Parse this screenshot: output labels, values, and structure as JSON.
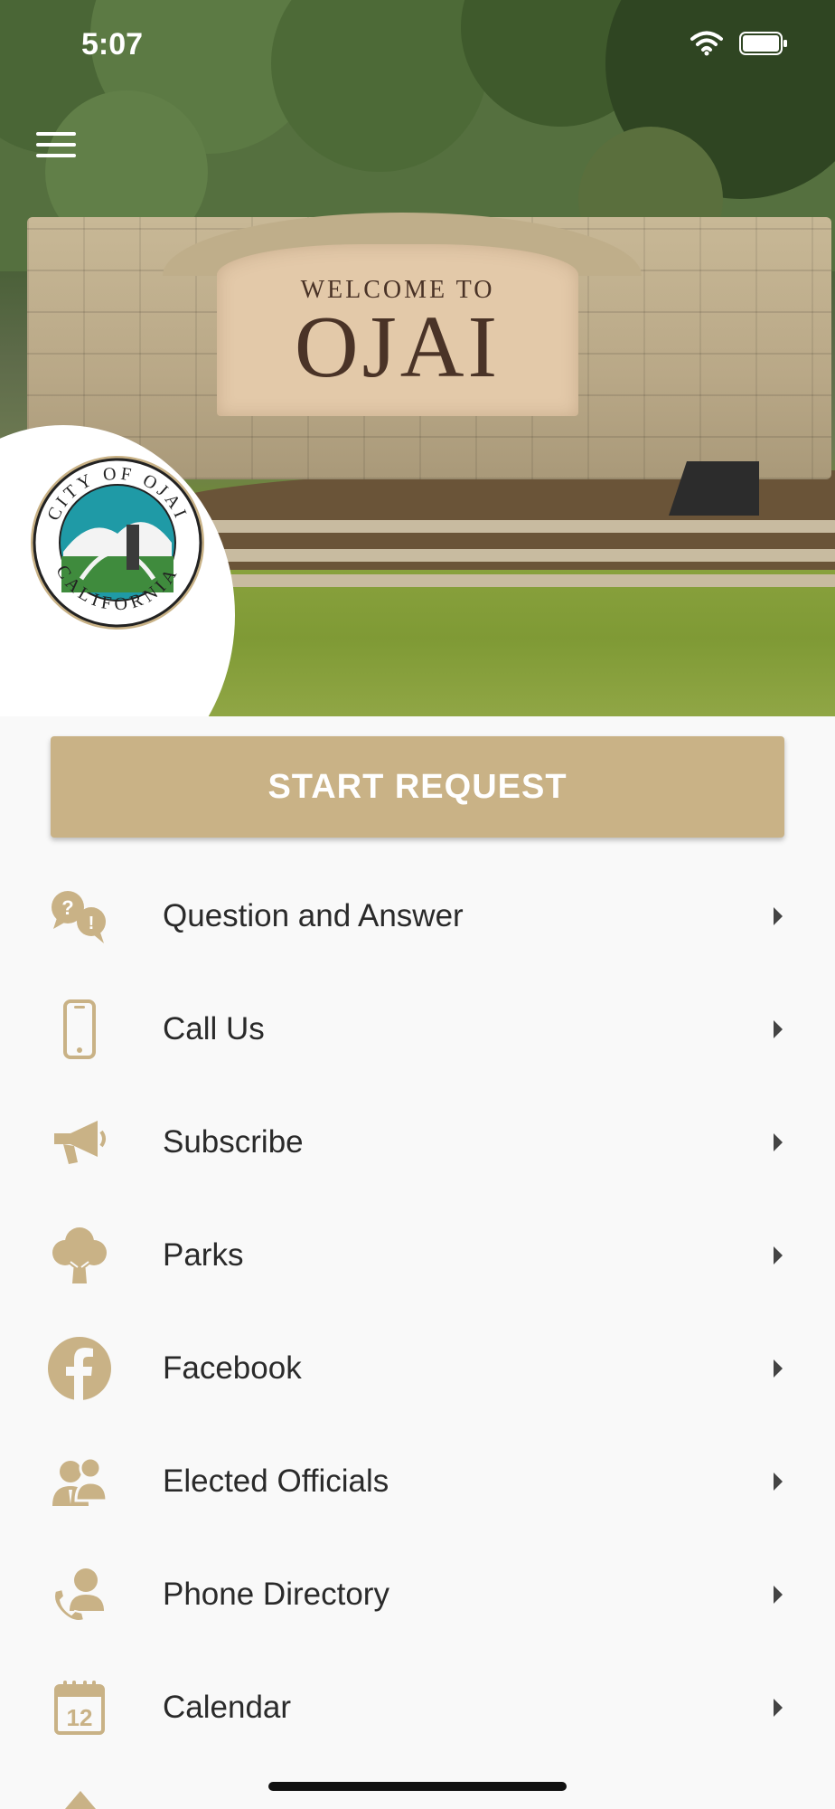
{
  "status_bar": {
    "time": "5:07"
  },
  "hero": {
    "sign_small_text": "WELCOME TO",
    "sign_big_text": "OJAI",
    "seal_top_text": "CITY OF OJAI",
    "seal_bottom_text": "CALIFORNIA"
  },
  "start_button": {
    "label": "START REQUEST"
  },
  "menu": {
    "items": [
      {
        "label": "Question and Answer",
        "icon": "question-answer-icon"
      },
      {
        "label": "Call Us",
        "icon": "mobile-phone-icon"
      },
      {
        "label": "Subscribe",
        "icon": "megaphone-icon"
      },
      {
        "label": "Parks",
        "icon": "tree-icon"
      },
      {
        "label": "Facebook",
        "icon": "facebook-icon"
      },
      {
        "label": "Elected Officials",
        "icon": "officials-icon"
      },
      {
        "label": "Phone Directory",
        "icon": "phone-directory-icon"
      },
      {
        "label": "Calendar",
        "icon": "calendar-icon"
      }
    ]
  },
  "colors": {
    "accent": "#c9b286",
    "text": "#2a2a2a",
    "background": "#f9f9f9"
  }
}
